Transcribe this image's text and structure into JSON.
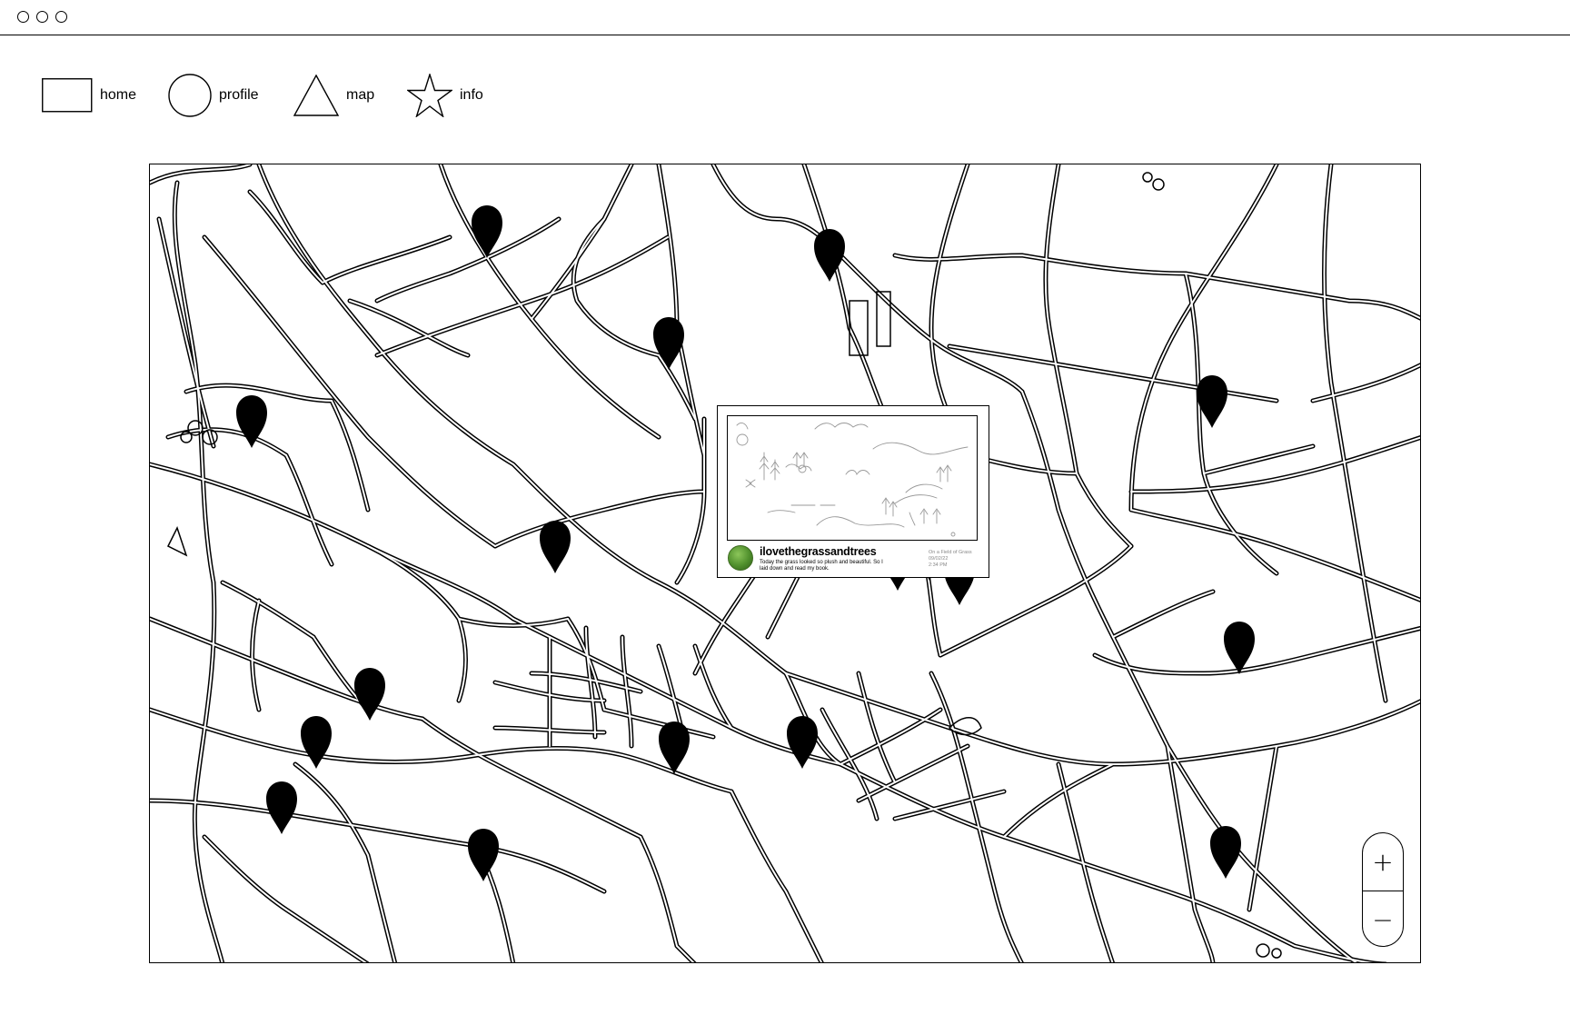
{
  "nav": {
    "home_label": "home",
    "profile_label": "profile",
    "map_label": "map",
    "info_label": "info"
  },
  "popup": {
    "username": "ilovethegrassandtrees",
    "caption": "Today the grass looked so plush and beautiful. So I laid down and read my book.",
    "location": "On a Field of Grass",
    "date": "09/02/22",
    "time": "2:34 PM"
  },
  "zoom": {
    "in_label": "+",
    "out_label": "−"
  },
  "map": {
    "pin_count": 17,
    "colors": {
      "pin": "#000000",
      "road": "#000000",
      "background": "#ffffff"
    }
  }
}
